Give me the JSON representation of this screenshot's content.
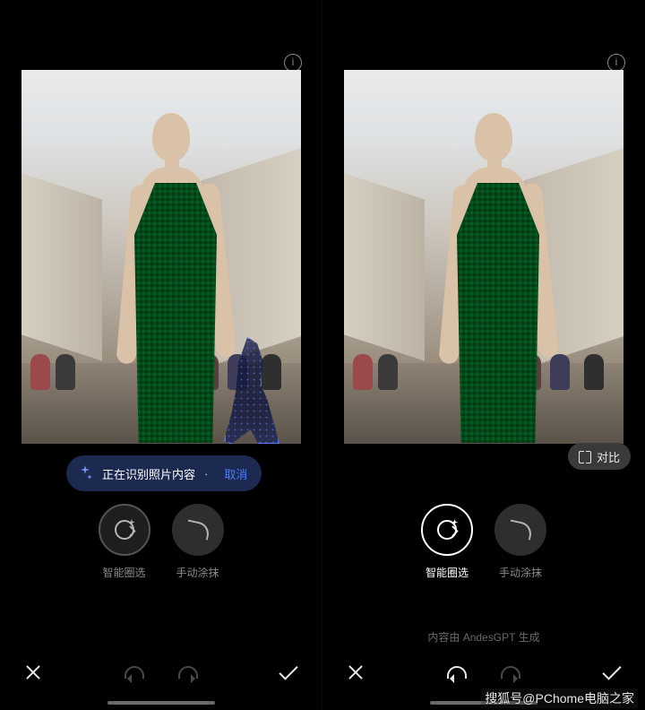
{
  "left": {
    "info_aria": "info",
    "status": {
      "icon": "sparkle-icon",
      "text": "正在识别照片内容",
      "dots": "·",
      "cancel": "取消"
    },
    "tools": {
      "smart_select": "智能圈选",
      "manual_brush": "手动涂抹"
    },
    "bottom": {
      "close": "close",
      "undo": "undo",
      "redo": "redo",
      "confirm": "confirm"
    }
  },
  "right": {
    "info_aria": "info",
    "compare": "对比",
    "tools": {
      "smart_select": "智能圈选",
      "manual_brush": "手动涂抹"
    },
    "caption": "内容由 AndesGPT 生成",
    "bottom": {
      "close": "close",
      "undo": "undo",
      "redo": "redo",
      "confirm": "confirm"
    }
  },
  "watermark": "搜狐号@PChome电脑之家"
}
